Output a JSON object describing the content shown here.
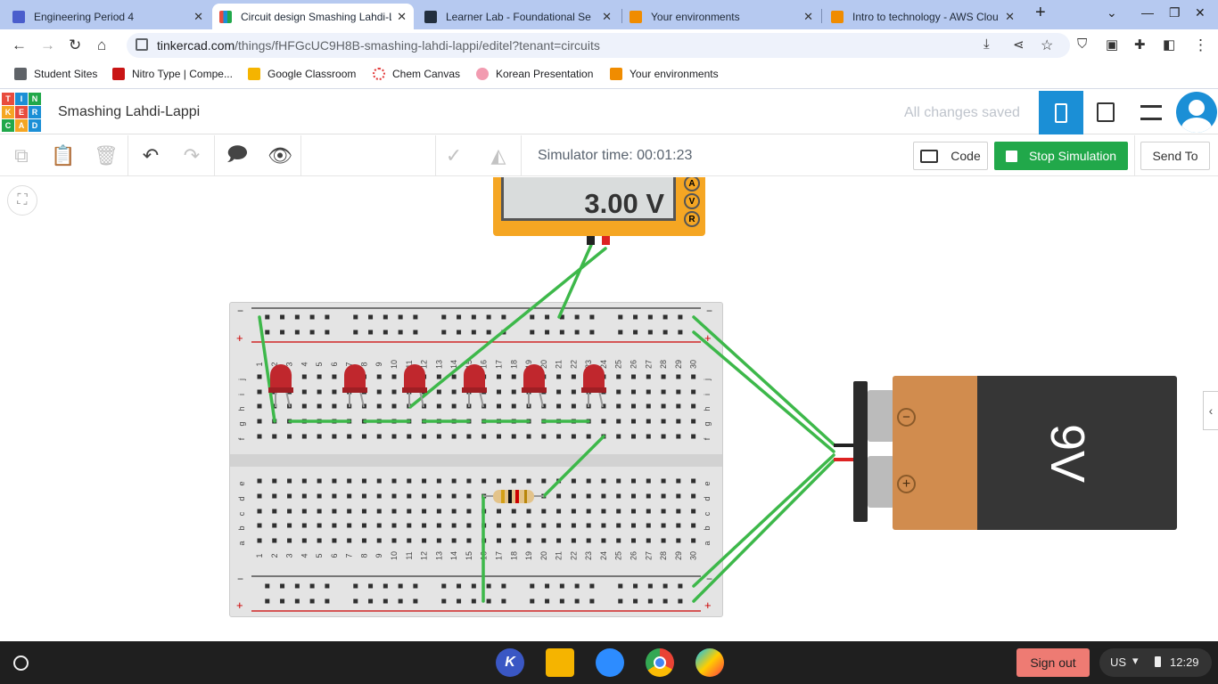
{
  "tabs": [
    {
      "title": "Engineering Period 4",
      "icon": "classroom-icon",
      "color": "#4a5dcc"
    },
    {
      "title": "Circuit design Smashing Lahdi-Lappi",
      "icon": "tinkercad-icon",
      "color": "#e84c3d"
    },
    {
      "title": "Learner Lab - Foundational Se",
      "icon": "aws-icon",
      "color": "#232f3e"
    },
    {
      "title": "Your environments",
      "icon": "box-icon",
      "color": "#f08c00"
    },
    {
      "title": "Intro to technology - AWS Clou",
      "icon": "box-icon",
      "color": "#f08c00"
    }
  ],
  "address": {
    "domain": "tinkercad.com",
    "path": "/things/fHFGcUC9H8B-smashing-lahdi-lappi/editel?tenant=circuits"
  },
  "bookmarks": [
    {
      "label": "Student Sites",
      "color": "#5f6368"
    },
    {
      "label": "Nitro Type | Compe...",
      "color": "#c91515"
    },
    {
      "label": "Google Classroom",
      "color": "#f5b400"
    },
    {
      "label": "Chem Canvas",
      "color": "#e23b3b"
    },
    {
      "label": "Korean Presentation",
      "color": "#f29bb0"
    },
    {
      "label": "Your environments",
      "color": "#f08c00"
    }
  ],
  "logo_letters": [
    "T",
    "I",
    "N",
    "K",
    "E",
    "R",
    "C",
    "A",
    "D"
  ],
  "project_title": "Smashing Lahdi-Lappi",
  "save_status": "All changes saved",
  "simulator_time": "Simulator time: 00:01:23",
  "buttons": {
    "code": "Code",
    "stop": "Stop Simulation",
    "send": "Send To"
  },
  "multimeter": {
    "reading": "3.00 V",
    "modes": [
      "A",
      "V",
      "R"
    ]
  },
  "battery": {
    "label": "9V",
    "minus": "−",
    "plus": "+"
  },
  "breadboard": {
    "columns": [
      "1",
      "2",
      "3",
      "4",
      "5",
      "6",
      "7",
      "8",
      "9",
      "10",
      "11",
      "12",
      "13",
      "14",
      "15",
      "16",
      "17",
      "18",
      "19",
      "20",
      "21",
      "22",
      "23",
      "24",
      "25",
      "26",
      "27",
      "28",
      "29",
      "30"
    ],
    "rows_top": [
      "j",
      "i",
      "h",
      "g",
      "f"
    ],
    "rows_bottom": [
      "e",
      "d",
      "c",
      "b",
      "a"
    ],
    "rail_minus": "−",
    "rail_plus": "+"
  },
  "taskbar": {
    "sign_out": "Sign out",
    "locale": "US",
    "time": "12:29"
  },
  "colors": {
    "tinkercad_blue": "#1b8fd6",
    "sim_green": "#21a84a",
    "wire": "#3db84a",
    "led": "#c0272d",
    "sign_out": "#ee7b73"
  }
}
